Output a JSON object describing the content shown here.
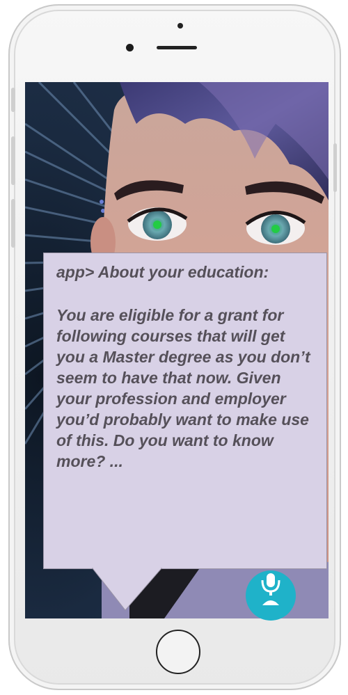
{
  "message": {
    "title": "app> About your education:",
    "body": "You are eligible for a grant for following courses that will get you a Master degree as you don’t seem to have that now. Given your profession and employer you’d probably want to make use of this. Do you want to know more? ..."
  },
  "icons": {
    "mic": "microphone-icon",
    "home": "home-button"
  },
  "colors": {
    "bubble": "#d8d1e6",
    "bubble_text": "#555059",
    "mic_button": "#1fb2c9",
    "hair": "#4b4a8c",
    "skin": "#d8a291"
  }
}
